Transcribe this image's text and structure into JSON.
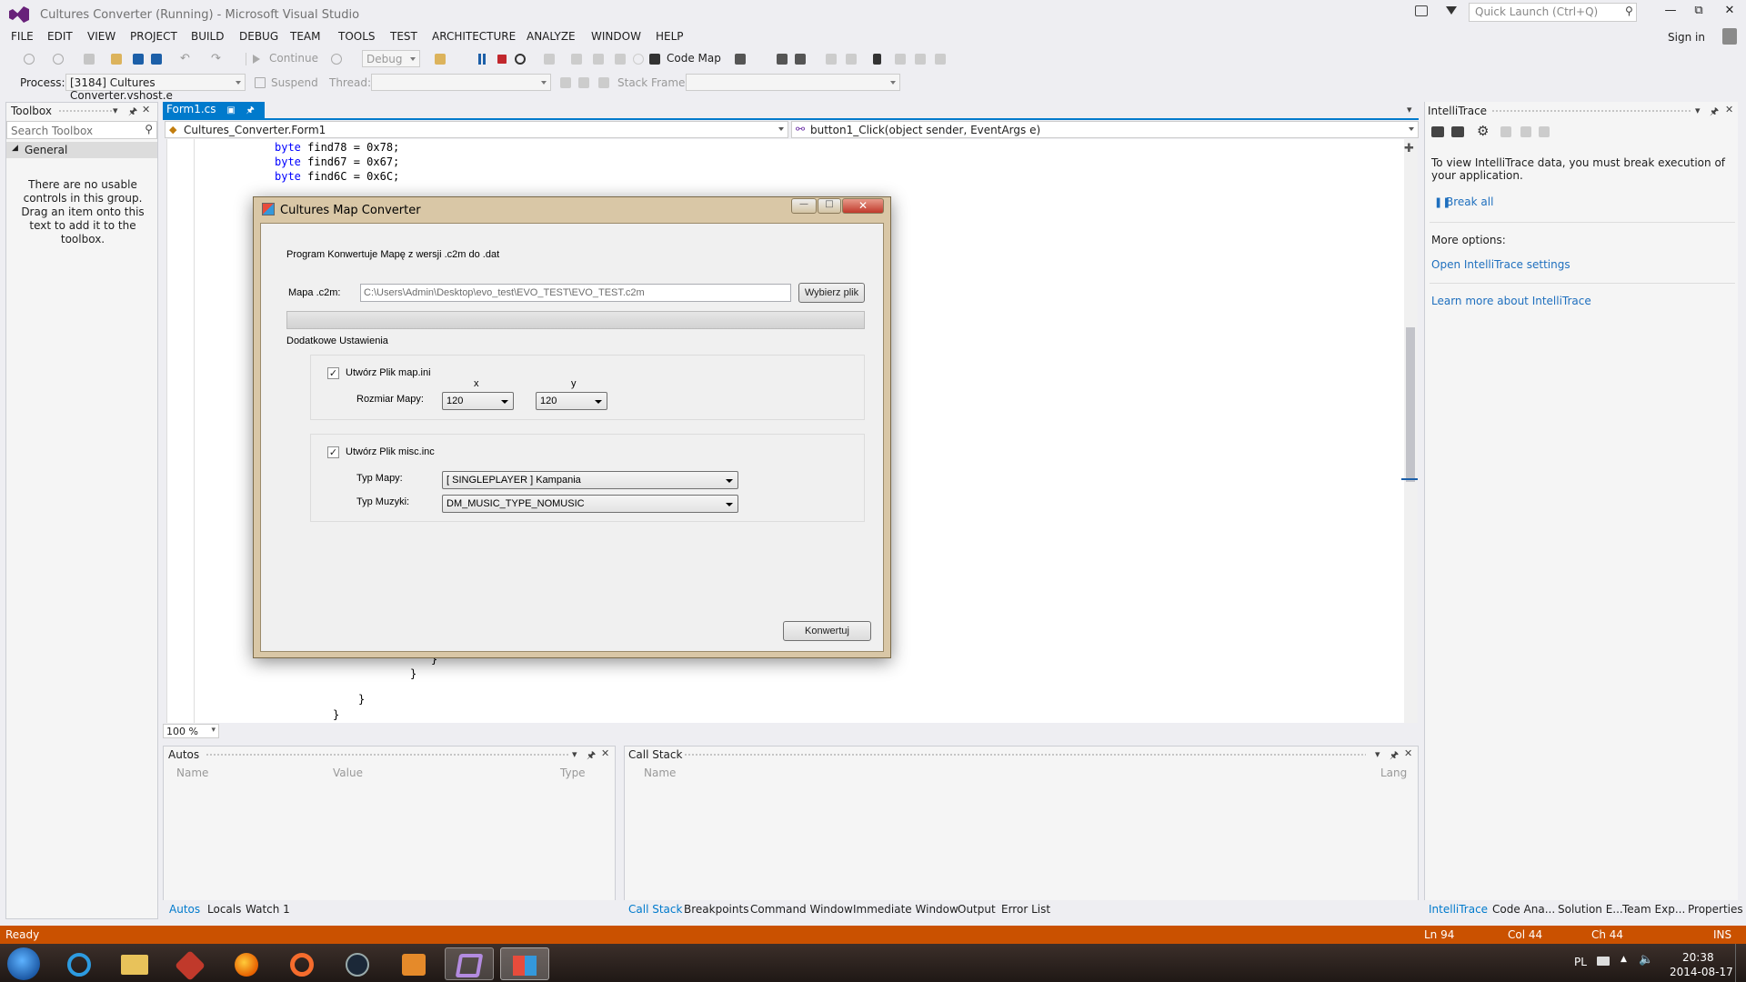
{
  "window": {
    "title": "Cultures Converter (Running) - Microsoft Visual Studio",
    "quick_launch_placeholder": "Quick Launch (Ctrl+Q)",
    "sign_in": "Sign in"
  },
  "menu": [
    "FILE",
    "EDIT",
    "VIEW",
    "PROJECT",
    "BUILD",
    "DEBUG",
    "TEAM",
    "TOOLS",
    "TEST",
    "ARCHITECTURE",
    "ANALYZE",
    "WINDOW",
    "HELP"
  ],
  "toolbar": {
    "continue_label": "Continue",
    "config_value": "Debug",
    "code_map_label": "Code Map",
    "process_label": "Process:",
    "process_value": "[3184] Cultures Converter.vshost.e",
    "suspend_label": "Suspend",
    "thread_label": "Thread:",
    "stack_frame_label": "Stack Frame:"
  },
  "toolbox": {
    "title": "Toolbox",
    "search_placeholder": "Search Toolbox",
    "group": "General",
    "empty_message": "There are no usable controls in this group. Drag an item onto this text to add it to the toolbox."
  },
  "editor": {
    "tab_label": "Form1.cs",
    "nav_left": "Cultures_Converter.Form1",
    "nav_right": "button1_Click(object sender, EventArgs e)",
    "zoom": "100 %",
    "code_top": [
      {
        "kw": "byte",
        "rest": " find78 = 0x78;"
      },
      {
        "kw": "byte",
        "rest": " find67 = 0x67;"
      },
      {
        "kw": "byte",
        "rest": " find6C = 0x6C;"
      }
    ],
    "code_bottom": [
      "}",
      "}",
      "}",
      "}"
    ]
  },
  "dialog": {
    "title": "Cultures Map Converter",
    "intro": "Program Konwertuje Mapę z wersji .c2m do .dat",
    "map_label": "Mapa .c2m:",
    "map_path": "C:\\Users\\Admin\\Desktop\\evo_test\\EVO_TEST\\EVO_TEST.c2m",
    "browse_button": "Wybierz plik",
    "progress": 0,
    "extra_settings": "Dodatkowe Ustawienia",
    "create_mapini": "Utwórz Plik map.ini",
    "create_mapini_checked": true,
    "x_label": "x",
    "y_label": "y",
    "map_size_label": "Rozmiar Mapy:",
    "size_x": "120",
    "size_y": "120",
    "create_misc": "Utwórz Plik misc.inc",
    "create_misc_checked": true,
    "map_type_label": "Typ Mapy:",
    "map_type_value": "[ SINGLEPLAYER ]  Kampania",
    "music_type_label": "Typ Muzyki:",
    "music_type_value": "DM_MUSIC_TYPE_NOMUSIC",
    "convert_button": "Konwertuj"
  },
  "autos": {
    "title": "Autos",
    "columns": [
      "Name",
      "Value",
      "Type"
    ],
    "tabs": [
      "Autos",
      "Locals",
      "Watch 1"
    ]
  },
  "callstack": {
    "title": "Call Stack",
    "columns": [
      "Name",
      "Lang"
    ],
    "tabs": [
      "Call Stack",
      "Breakpoints",
      "Command Window",
      "Immediate Window",
      "Output",
      "Error List"
    ]
  },
  "intellitrace": {
    "title": "IntelliTrace",
    "message": "To view IntelliTrace data, you must break execution of your application.",
    "break_all": "Break all",
    "more_options": "More options:",
    "settings_link": "Open IntelliTrace settings",
    "learn_more": "Learn more about IntelliTrace",
    "tabs": [
      "IntelliTrace",
      "Code Ana...",
      "Solution E...",
      "Team Exp...",
      "Properties"
    ]
  },
  "status": {
    "state": "Ready",
    "line": "Ln 94",
    "col": "Col 44",
    "ch": "Ch 44",
    "mode": "INS"
  },
  "taskbar": {
    "lang": "PL",
    "time": "20:38",
    "date": "2014-08-17"
  },
  "colors": {
    "accent": "#007acc",
    "status_bar": "#ca5100",
    "link": "#1e6fbe"
  }
}
